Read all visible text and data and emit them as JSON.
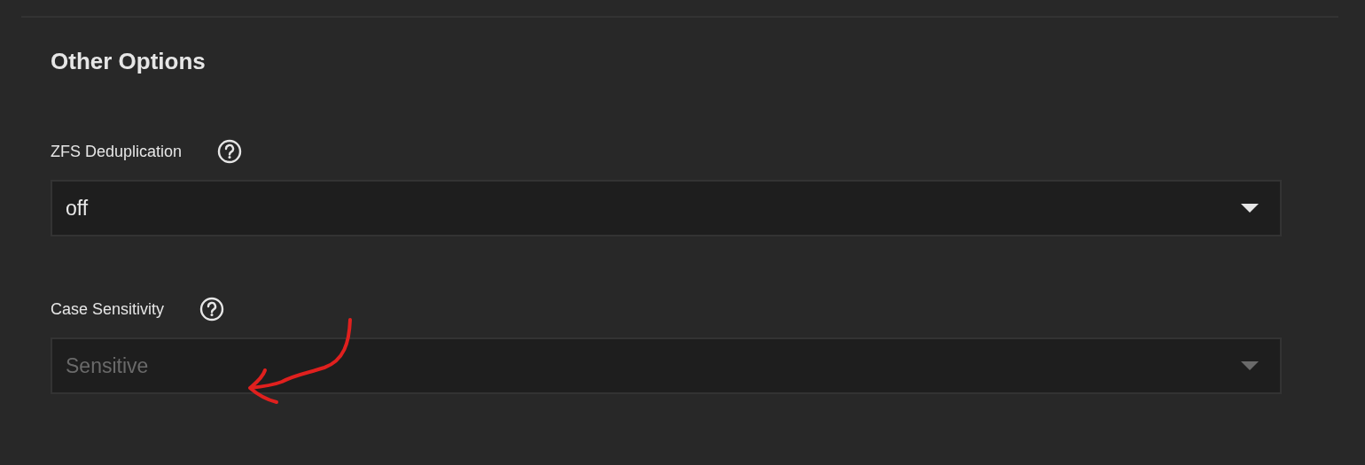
{
  "section": {
    "title": "Other Options"
  },
  "fields": [
    {
      "label": "ZFS Deduplication",
      "value": "off",
      "disabled": false
    },
    {
      "label": "Case Sensitivity",
      "value": "Sensitive",
      "disabled": true
    }
  ],
  "annotations": [
    {
      "kind": "arrow",
      "color": "#e0201e"
    }
  ]
}
